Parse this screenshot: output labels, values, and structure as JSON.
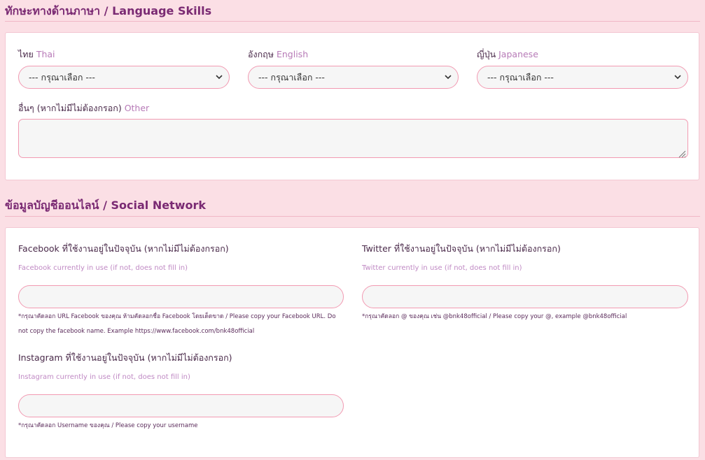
{
  "language": {
    "title": "ทักษะทางด้านภาษา / Language Skills",
    "thai": {
      "label_th": "ไทย",
      "label_en": "Thai",
      "value": "--- กรุณาเลือก ---"
    },
    "english": {
      "label_th": "อังกฤษ",
      "label_en": "English",
      "value": "--- กรุณาเลือก ---"
    },
    "japanese": {
      "label_th": "ญี่ปุ่น",
      "label_en": "Japanese",
      "value": "--- กรุณาเลือก ---"
    },
    "other": {
      "label_th": "อื่นๆ (หากไม่มีไม่ต้องกรอก)",
      "label_en": "Other",
      "value": ""
    }
  },
  "social": {
    "title": "ข้อมูลบัญชีออนไลน์ / Social Network",
    "facebook": {
      "label": "Facebook ที่ใช้งานอยู่ในปัจจุบัน (หากไม่มีไม่ต้องกรอก)",
      "hint": "Facebook currently in use (if not, does not fill in)",
      "value": "",
      "note": "*กรุณาคัดลอก URL Facebook ของคุณ ห้ามคัดลอกชื่อ Facebook โดยเด็ดขาด / Please copy your Facebook URL. Do not copy the facebook name. Example https://www.facebook.com/bnk48official"
    },
    "twitter": {
      "label": "Twitter ที่ใช้งานอยู่ในปัจจุบัน (หากไม่มีไม่ต้องกรอก)",
      "hint": "Twitter currently in use (if not, does not fill in)",
      "value": "",
      "note": "*กรุณาคัดลอก @ ของคุณ เช่น @bnk48official / Please copy your  @, example @bnk48official"
    },
    "instagram": {
      "label": "Instagram ที่ใช้งานอยู่ในปัจจุบัน (หากไม่มีไม่ต้องกรอก)",
      "hint": "Instagram currently in use (if not, does not fill in)",
      "value": "",
      "note": "*กรุณาคัดลอก Username ของคุณ / Please copy your username"
    }
  },
  "colors": {
    "background": "#fbdfe5",
    "title": "#7a2a73",
    "border": "#f29ab2",
    "hint": "#c08ac4"
  },
  "icons": {
    "select": "chevron-down-icon",
    "textarea": "resize-grip-icon"
  }
}
